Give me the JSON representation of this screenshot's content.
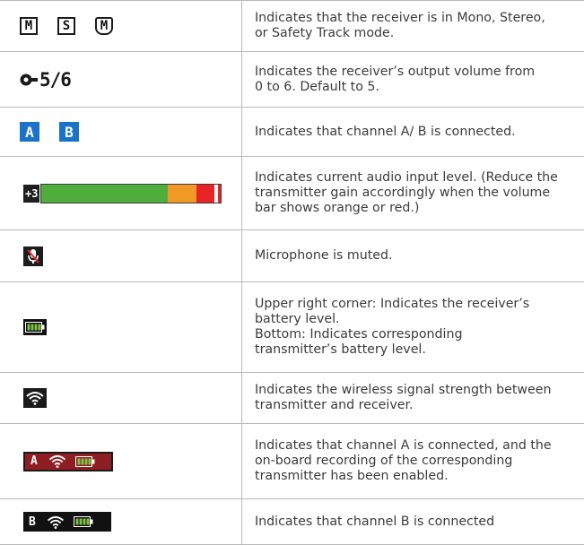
{
  "rows": [
    {
      "description": "Indicates that the receiver is in Mono, Stereo,\nor Safety Track mode.",
      "icons": [
        "M",
        "S",
        "M"
      ]
    },
    {
      "description": "Indicates the receiver’s output volume from\n0 to 6. Default to 5.",
      "volume": "5/6"
    },
    {
      "description": "Indicates that channel A/ B is connected.",
      "channels": [
        "A",
        "B"
      ]
    },
    {
      "description": "Indicates current audio input level. (Reduce the\ntransmitter gain accordingly when the volume\nbar shows orange or red.)",
      "level_label": "+3"
    },
    {
      "description": "Microphone is muted."
    },
    {
      "description": "Upper right corner: Indicates the receiver’s\nbattery level.\nBottom: Indicates corresponding\ntransmitter’s battery level."
    },
    {
      "description": "Indicates the wireless signal strength between\ntransmitter and receiver."
    },
    {
      "description": "Indicates that channel A is connected, and the\non-board recording of the corresponding\ntransmitter has been enabled.",
      "channel": "A"
    },
    {
      "description": "Indicates that channel B is connected",
      "channel": "B"
    }
  ],
  "colors": {
    "channel_blue": "#1a73c9",
    "level_green": "#4fad3c",
    "level_orange": "#f09a25",
    "level_red": "#e82424",
    "recording_red": "#8e1e22",
    "battery_green": "#7dc242"
  },
  "icon_names": [
    "mono-mode-icon",
    "stereo-mode-icon",
    "safety-track-mode-icon",
    "output-volume-icon",
    "channel-a-icon",
    "channel-b-icon",
    "audio-level-meter",
    "mic-muted-icon",
    "battery-icon",
    "wifi-signal-icon",
    "channel-a-recording-status",
    "channel-b-status"
  ]
}
